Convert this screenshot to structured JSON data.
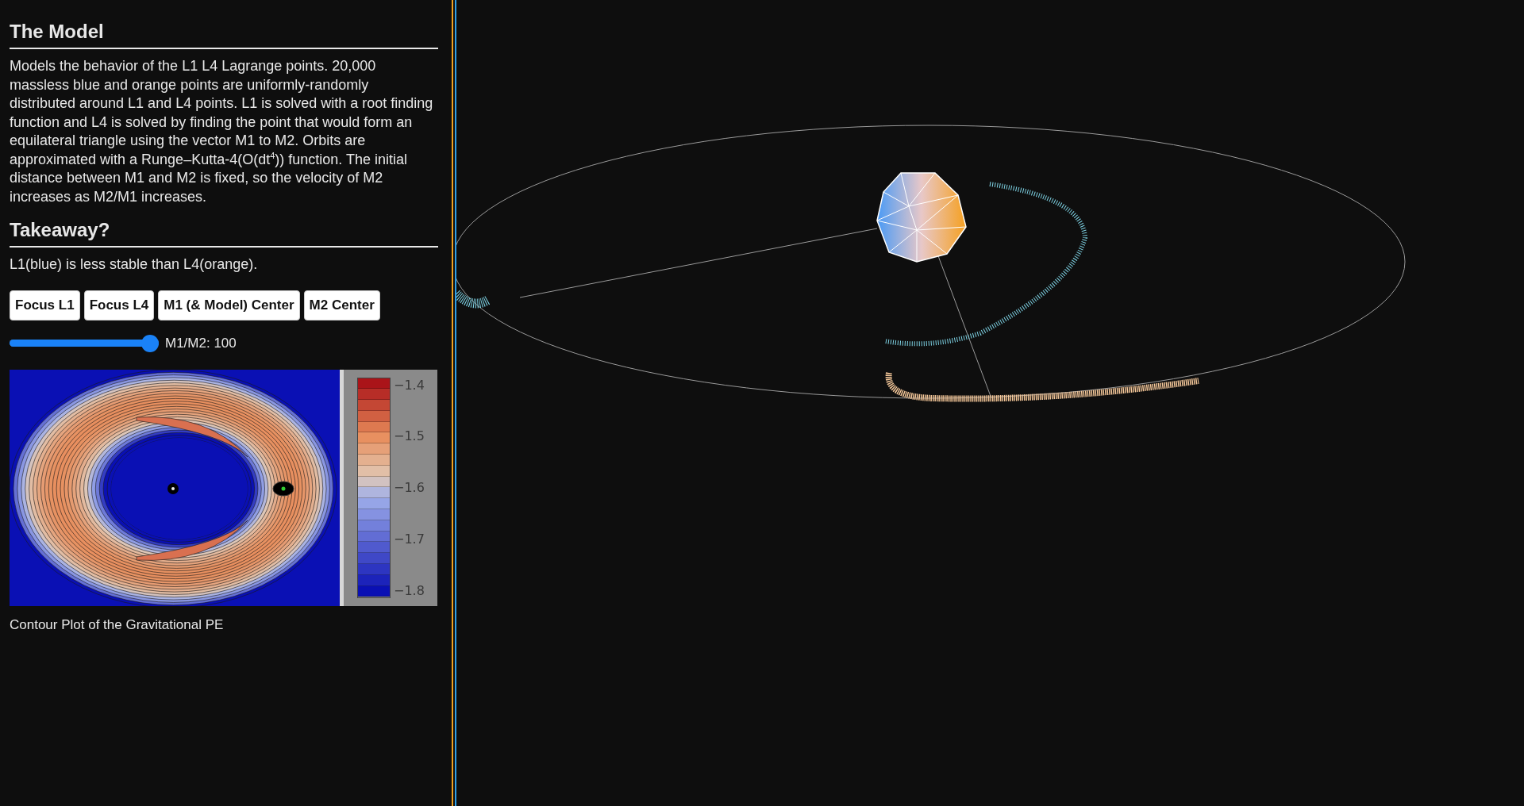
{
  "sections": [
    {
      "heading": "The Model",
      "body": "Models the behavior of the L1 L4 Lagrange points. 20,000 massless blue and orange points are uniformly-randomly distributed around L1 and L4 points. L1 is solved with a root finding function and L4 is solved by finding the point that would form an equilateral triangle using the vector M1 to M2. Orbits are approximated with a Runge–Kutta-4(O(dt$^{4}$)) function. The initial distance between M1 and M2 is fixed, so the velocity of M2 increases as M2/M1 increases."
    },
    {
      "heading": "Takeaway?",
      "body": "L1(blue) is less stable than L4(orange)."
    }
  ],
  "buttons": [
    "Focus L1",
    "Focus L4",
    "M1 (& Model) Center",
    "M2 Center"
  ],
  "slider": {
    "level": 1,
    "reading": "M1/M2: 100"
  },
  "contour_plot": {
    "colorbar_ticks": [
      "−1.4",
      "−1.5",
      "−1.6",
      "−1.7",
      "−1.8"
    ],
    "caption": "Contour Plot of the Gravitational PE"
  }
}
